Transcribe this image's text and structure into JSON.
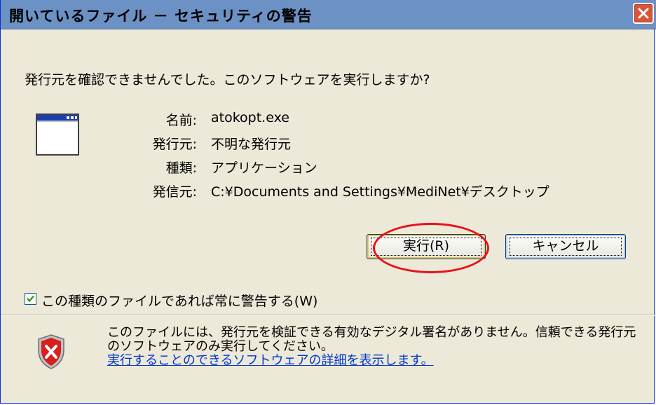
{
  "window": {
    "title": "開いているファイル － セキュリティの警告",
    "close_glyph": "✕"
  },
  "question": "発行元を確認できませんでした。このソフトウェアを実行しますか?",
  "details": [
    {
      "label": "名前:",
      "value": "atokopt.exe"
    },
    {
      "label": "発行元:",
      "value": "不明な発行元"
    },
    {
      "label": "種類:",
      "value": "アプリケーション"
    },
    {
      "label": "発信元:",
      "value": "C:¥Documents and Settings¥MediNet¥デスクトップ"
    }
  ],
  "buttons": {
    "run": "実行(R)",
    "cancel": "キャンセル"
  },
  "checkbox": {
    "label": "この種類のファイルであれば常に警告する(W)",
    "checked": true
  },
  "warning": {
    "text": "このファイルには、発行元を検証できる有効なデジタル署名がありません。信頼できる発行元のソフトウェアのみ実行してください。",
    "link": "実行することのできるソフトウェアの詳細を表示します。"
  },
  "icons": {
    "app": "application-window-icon",
    "shield": "security-shield-icon",
    "close": "close-icon"
  },
  "colors": {
    "titlebar": "#6c91c4",
    "close": "#d8553a",
    "highlight": "#e8101a",
    "link": "#0033cc",
    "dialog_bg": "#ece9d8"
  }
}
